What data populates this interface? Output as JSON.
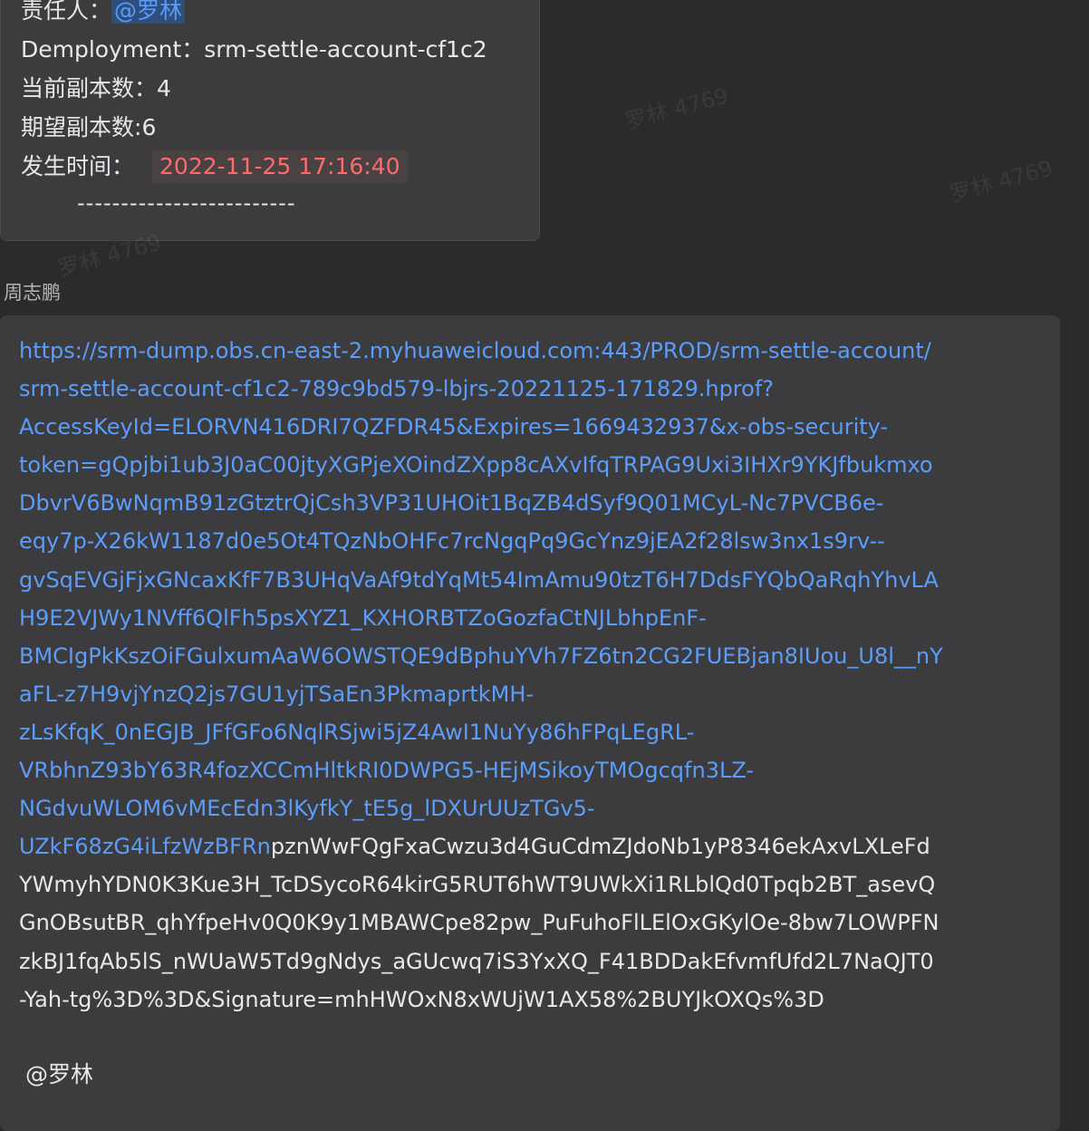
{
  "alert": {
    "owner_label": "责任人：",
    "owner_mention": "@罗林",
    "deployment_label": "Demployment：",
    "deployment_value": "srm-settle-account-cf1c2",
    "current_replicas_label": "当前副本数：",
    "current_replicas_value": "4",
    "desired_replicas_label": "期望副本数:",
    "desired_replicas_value": "6",
    "time_label": "发生时间：",
    "time_value": "2022-11-25 17:16:40",
    "divider": "-------------------------"
  },
  "reply": {
    "sender": "周志鹏",
    "link_lines": [
      "https://srm-dump.obs.cn-east-2.myhuaweicloud.com:443/PROD/srm-settle-account/",
      "srm-settle-account-cf1c2-789c9bd579-lbjrs-20221125-171829.hprof?",
      "AccessKeyId=ELORVN416DRI7QZFDR45&Expires=1669432937&x-obs-security-",
      "token=gQpjbi1ub3J0aC00jtyXGPjeXOindZXpp8cAXvIfqTRPAG9Uxi3IHXr9YKJfbukmxo",
      "DbvrV6BwNqmB91zGtztrQjCsh3VP31UHOit1BqZB4dSyf9Q01MCyL-Nc7PVCB6e-",
      "eqy7p-X26kW1187d0e5Ot4TQzNbOHFc7rcNgqPq9GcYnz9jEA2f28lsw3nx1s9rv--",
      "gvSqEVGjFjxGNcaxKfF7B3UHqVaAf9tdYqMt54ImAmu90tzT6H7DdsFYQbQaRqhYhvLA",
      "H9E2VJWy1NVff6QlFh5psXYZ1_KXHORBTZoGozfaCtNJLbhpEnF-",
      "BMCIgPkKszOiFGulxumAaW6OWSTQE9dBphuYVh7FZ6tn2CG2FUEBjan8IUou_U8l__nY",
      "aFL-z7H9vjYnzQ2js7GU1yjTSaEn3PkmaprtkMH-",
      "zLsKfqK_0nEGJB_JFfGFo6NqlRSjwi5jZ4AwI1NuYy86hFPqLEgRL-",
      "VRbhnZ93bY63R4fozXCCmHltkRI0DWPG5-HEjMSikoyTMOgcqfn3LZ-",
      "NGdvuWLOM6vMEcEdn3lKyfkY_tE5g_lDXUrUUzTGv5-"
    ],
    "mixed_line_link_part": "UZkF68zG4iLfzWzBFRn",
    "mixed_line_plain_part": "pznWwFQgFxaCwzu3d4GuCdmZJdoNb1yP8346ekAxvLXLeFd",
    "plain_lines": [
      "YWmyhYDN0K3Kue3H_TcDSycoR64kirG5RUT6hWT9UWkXi1RLblQd0Tpqb2BT_asevQ",
      "GnOBsutBR_qhYfpeHv0Q0K9y1MBAWCpe82pw_PuFuhoFlLElOxGKylOe-8bw7LOWPFN",
      "zkBJ1fqAb5lS_nWUaW5Td9gNdys_aGUcwq7iS3YxXQ_F41BDDakEfvmfUfd2L7NaQJT0",
      "-Yah-tg%3D%3D&Signature=mhHWOxN8xWUjW1AX58%2BUYJkOXQs%3D"
    ],
    "mention": "@罗林"
  },
  "watermark": "罗林 4769"
}
